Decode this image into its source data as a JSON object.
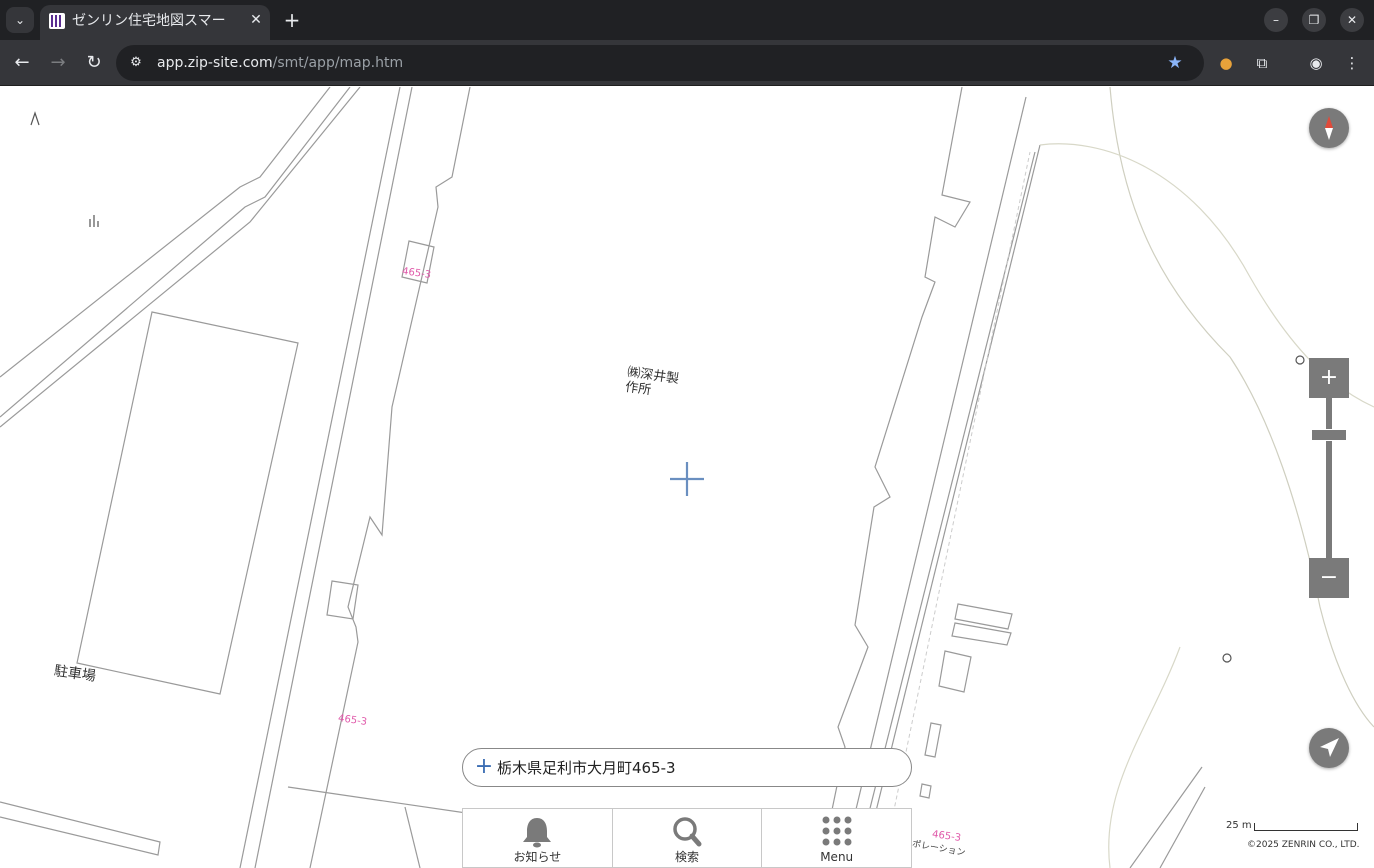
{
  "browser": {
    "tab_title": "ゼンリン住宅地図スマー",
    "url_host": "app.zip-site.com",
    "url_path": "/smt/app/map.htm"
  },
  "map": {
    "building_name": "㈱深井製作所",
    "parking_label": "駐車場",
    "lot_number_top": "465-3",
    "lot_number_bottom": "465-3",
    "lot_number_right": "465-3",
    "small_label": "ポレーション",
    "address_text": "栃木県足利市大月町465-3",
    "scale_label": "25 m",
    "copyright": "©2025 ZENRIN CO., LTD.",
    "colors": {
      "control_gray": "#7a7a7a",
      "crosshair": "#6a8fc0",
      "lot_number": "#e05aaa"
    }
  },
  "bottom_nav": {
    "items": [
      {
        "label": "お知らせ",
        "icon": "bell-icon"
      },
      {
        "label": "検索",
        "icon": "search-icon"
      },
      {
        "label": "Menu",
        "icon": "grid-menu-icon"
      }
    ]
  }
}
